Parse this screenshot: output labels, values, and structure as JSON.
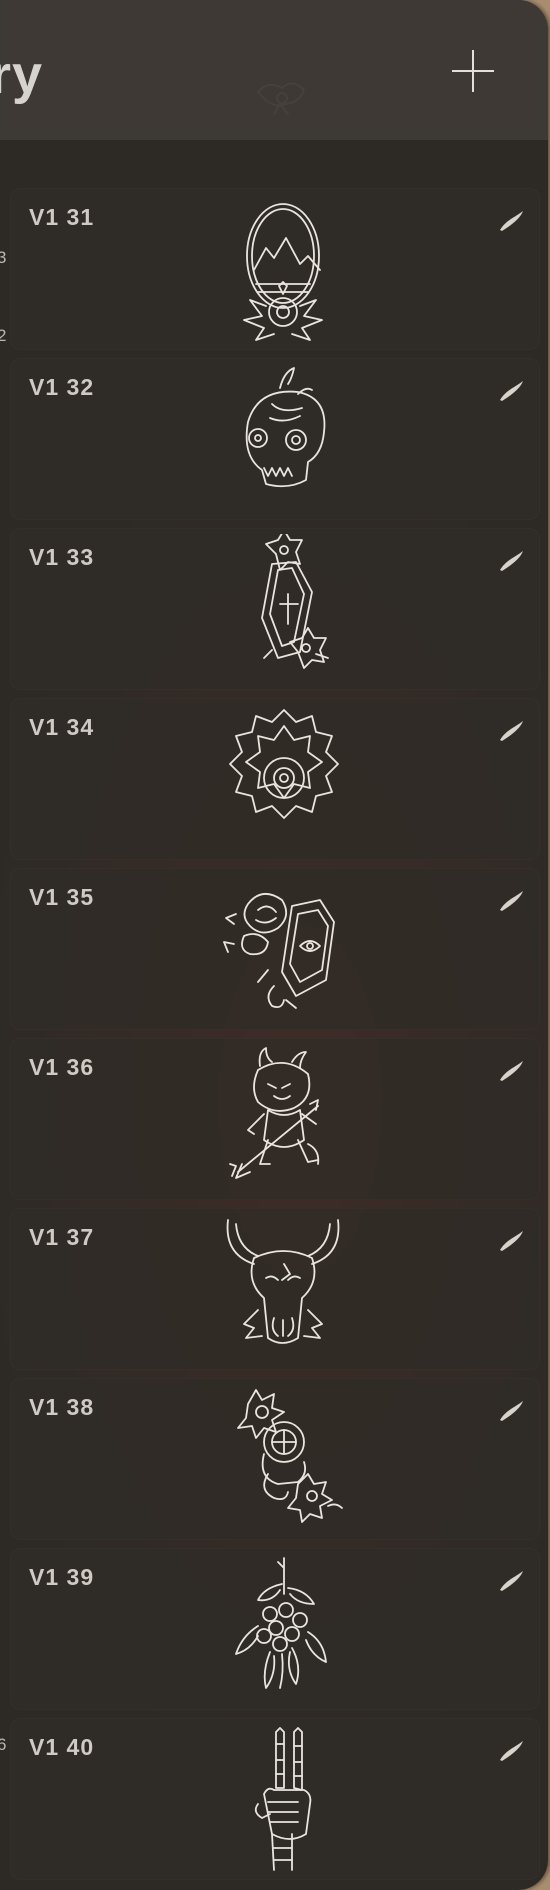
{
  "header": {
    "title_partial": "ry",
    "add_button": "add-brush"
  },
  "side_marks": [
    "3",
    "2",
    "6"
  ],
  "brushes": [
    {
      "name": "V1 31",
      "thumbnail": "mountain-oval-flower"
    },
    {
      "name": "V1 32",
      "thumbnail": "melting-skull"
    },
    {
      "name": "V1 33",
      "thumbnail": "coffin-flowers"
    },
    {
      "name": "V1 34",
      "thumbnail": "mandala-flower"
    },
    {
      "name": "V1 35",
      "thumbnail": "flowers-lantern-eye"
    },
    {
      "name": "V1 36",
      "thumbnail": "little-devil"
    },
    {
      "name": "V1 37",
      "thumbnail": "bull-skull"
    },
    {
      "name": "V1 38",
      "thumbnail": "diving-helmet"
    },
    {
      "name": "V1 39",
      "thumbnail": "berry-branch"
    },
    {
      "name": "V1 40",
      "thumbnail": "skeleton-peace-hand"
    }
  ]
}
